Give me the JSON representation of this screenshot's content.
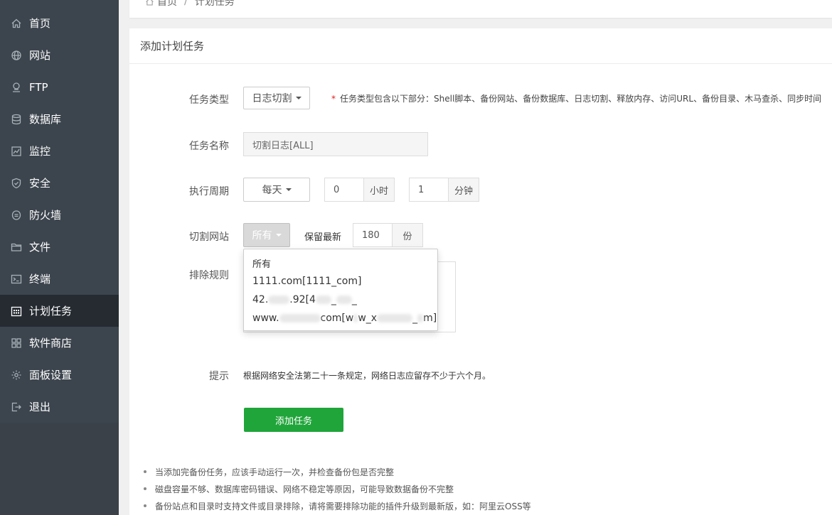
{
  "sidebar": {
    "items": [
      {
        "label": "首页",
        "icon": "home-icon",
        "active": false
      },
      {
        "label": "网站",
        "icon": "globe-icon",
        "active": false
      },
      {
        "label": "FTP",
        "icon": "ftp-icon",
        "active": false
      },
      {
        "label": "数据库",
        "icon": "database-icon",
        "active": false
      },
      {
        "label": "监控",
        "icon": "monitor-icon",
        "active": false
      },
      {
        "label": "安全",
        "icon": "shield-icon",
        "active": false
      },
      {
        "label": "防火墙",
        "icon": "firewall-icon",
        "active": false
      },
      {
        "label": "文件",
        "icon": "folder-icon",
        "active": false
      },
      {
        "label": "终端",
        "icon": "terminal-icon",
        "active": false
      },
      {
        "label": "计划任务",
        "icon": "calendar-icon",
        "active": true
      },
      {
        "label": "软件商店",
        "icon": "apps-icon",
        "active": false
      },
      {
        "label": "面板设置",
        "icon": "gear-icon",
        "active": false
      },
      {
        "label": "退出",
        "icon": "logout-icon",
        "active": false
      }
    ]
  },
  "breadcrumb": {
    "home": "首页",
    "separator": "/",
    "current": "计划任务"
  },
  "form": {
    "title": "添加计划任务",
    "task_type": {
      "label": "任务类型",
      "value": "日志切割",
      "hint_star": "*",
      "hint": "任务类型包含以下部分：Shell脚本、备份网站、备份数据库、日志切割、释放内存、访问URL、备份目录、木马查杀、同步时间"
    },
    "task_name": {
      "label": "任务名称",
      "value": "切割日志[ALL]"
    },
    "period": {
      "label": "执行周期",
      "value": "每天",
      "hour": "0",
      "hour_unit": "小时",
      "minute": "1",
      "minute_unit": "分钟"
    },
    "site": {
      "label": "切割网站",
      "value": "所有",
      "keep_label": "保留最新",
      "keep_value": "180",
      "keep_unit": "份",
      "options": [
        "所有",
        "1111.com[1111_com]",
        "42.",
        ".92[4",
        "_",
        "www.",
        "com[w",
        "w_x",
        "_",
        "m]"
      ]
    },
    "exclude": {
      "label": "排除规则"
    },
    "tip": {
      "label": "提示",
      "text": "根据网络安全法第二十一条规定，网络日志应留存不少于六个月。"
    },
    "submit_label": "添加任务"
  },
  "notes": [
    "当添加完备份任务，应该手动运行一次，并检查备份包是否完整",
    "磁盘容量不够、数据库密码错误、网络不稳定等原因，可能导致数据备份不完整",
    "备份站点和目录时支持文件或目录排除，请将需要排除功能的插件升级到最新版，如：阿里云OSS等"
  ],
  "colors": {
    "sidebar_bg": "#3c444d",
    "sidebar_active": "#252b31",
    "primary": "#20a53a",
    "required": "#e02020"
  }
}
